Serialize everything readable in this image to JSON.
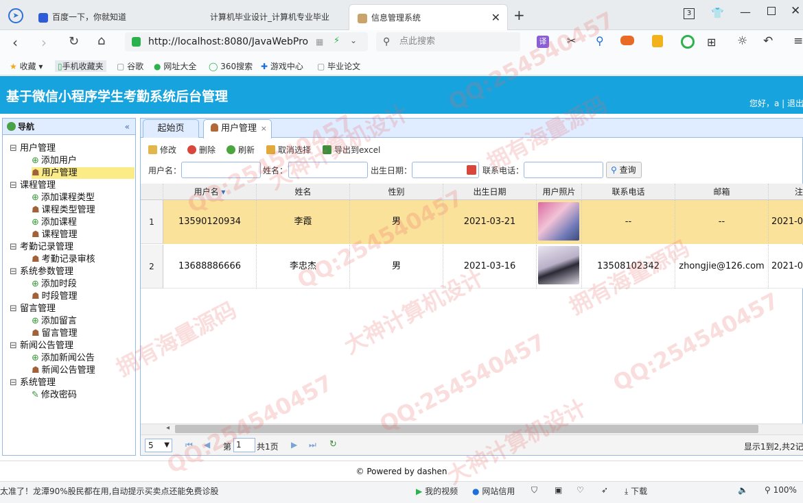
{
  "browser": {
    "tabs": [
      {
        "label": "百度一下，你就知道"
      },
      {
        "label": "计算机毕业设计_计算机专业毕业"
      },
      {
        "label": "信息管理系统"
      }
    ],
    "tab_count": "3",
    "url": "http://localhost:8080/JavaWebPro",
    "search_placeholder": "点此搜索",
    "bookmarks": [
      "收藏",
      "手机收藏夹",
      "谷歌",
      "网址大全",
      "360搜索",
      "游戏中心",
      "毕业论文"
    ]
  },
  "app": {
    "title": "基于微信小程序学生考勤系统后台管理",
    "user_bar": "您好，a | 退出"
  },
  "west": {
    "title": "导航",
    "tree": [
      {
        "label": "用户管理",
        "level": 0
      },
      {
        "label": "添加用户",
        "level": 1
      },
      {
        "label": "用户管理",
        "level": 1,
        "selected": true
      },
      {
        "label": "课程管理",
        "level": 0
      },
      {
        "label": "添加课程类型",
        "level": 1
      },
      {
        "label": "课程类型管理",
        "level": 1
      },
      {
        "label": "添加课程",
        "level": 1
      },
      {
        "label": "课程管理",
        "level": 1
      },
      {
        "label": "考勤记录管理",
        "level": 0
      },
      {
        "label": "考勤记录审核",
        "level": 1
      },
      {
        "label": "系统参数管理",
        "level": 0
      },
      {
        "label": "添加时段",
        "level": 1
      },
      {
        "label": "时段管理",
        "level": 1
      },
      {
        "label": "留言管理",
        "level": 0
      },
      {
        "label": "添加留言",
        "level": 1
      },
      {
        "label": "留言管理",
        "level": 1
      },
      {
        "label": "新闻公告管理",
        "level": 0
      },
      {
        "label": "添加新闻公告",
        "level": 1
      },
      {
        "label": "新闻公告管理",
        "level": 1
      },
      {
        "label": "系统管理",
        "level": 0
      },
      {
        "label": "修改密码",
        "level": 1
      }
    ]
  },
  "center": {
    "tabs": [
      {
        "label": "起始页"
      },
      {
        "label": "用户管理"
      }
    ],
    "toolbar": [
      "修改",
      "删除",
      "刷新",
      "取消选择",
      "导出到excel"
    ],
    "filters": {
      "username_label": "用户名：",
      "name_label": "姓名：",
      "birth_label": "出生日期：",
      "phone_label": "联系电话：",
      "query_label": "查询"
    },
    "columns": [
      "用户名",
      "姓名",
      "性别",
      "出生日期",
      "用户照片",
      "联系电话",
      "邮箱",
      "注"
    ],
    "rows": [
      {
        "no": "1",
        "username": "13590120934",
        "name": "李霞",
        "gender": "男",
        "birth": "2021-03-21",
        "phone": "--",
        "email": "--",
        "extra": "2021-0"
      },
      {
        "no": "2",
        "username": "13688886666",
        "name": "李忠杰",
        "gender": "男",
        "birth": "2021-03-16",
        "phone": "13508102342",
        "email": "zhongjie@126.com",
        "extra": "2021-0"
      }
    ],
    "pager": {
      "page_size": "5",
      "page_prefix": "第",
      "page_value": "1",
      "page_suffix": "共1页",
      "summary": "显示1到2,共2记"
    }
  },
  "footer": {
    "text": "© Powered by dashen"
  },
  "statusbar": {
    "news": "太准了！龙潭90%股民都在用,自动提示买卖点还能免费诊股",
    "items": [
      "我的视频",
      "网站信用",
      "下载"
    ],
    "zoom": "100%"
  },
  "watermarks": [
    "QQ:254540457",
    "拥有海量源码",
    "大神计算机设计"
  ]
}
